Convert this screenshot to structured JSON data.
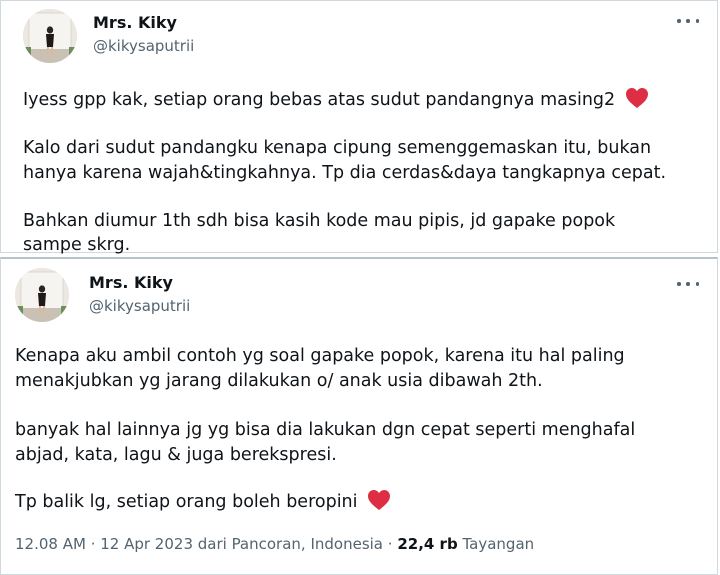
{
  "tweet1": {
    "name": "Mrs. Kiky",
    "handle": "@kikysaputrii",
    "lines": [
      "Iyess gpp kak, setiap orang bebas atas sudut pandangnya masing2",
      "Kalo dari sudut pandangku kenapa cipung semenggemaskan itu, bukan",
      "hanya karena wajah&tingkahnya. Tp dia cerdas&daya tangkapnya cepat.",
      "Bahkan diumur 1th sdh bisa kasih kode mau pipis, jd gapake popok",
      "sampe skrg."
    ],
    "emoji": "heart-emoji"
  },
  "tweet2": {
    "name": "Mrs. Kiky",
    "handle": "@kikysaputrii",
    "lines": [
      "Kenapa aku ambil contoh yg soal gapake popok, karena itu hal paling",
      "menakjubkan yg jarang dilakukan o/ anak usia dibawah 2th.",
      "banyak hal lainnya jg yg bisa dia lakukan dgn cepat seperti menghafal",
      "abjad, kata, lagu & juga berekspresi.",
      "Tp balik lg, setiap orang boleh beropini"
    ],
    "emoji": "heart-emoji",
    "meta": {
      "time": "12.08 AM",
      "sep1": " · ",
      "date": "12 Apr 2023 dari Pancoran, Indonesia",
      "sep2": " · ",
      "views_count": "22,4 rb",
      "views_label": " Tayangan"
    }
  },
  "colors": {
    "text": "#0f1419",
    "secondary": "#536471",
    "border": "#cfd9de",
    "heart": "#e0245e"
  }
}
